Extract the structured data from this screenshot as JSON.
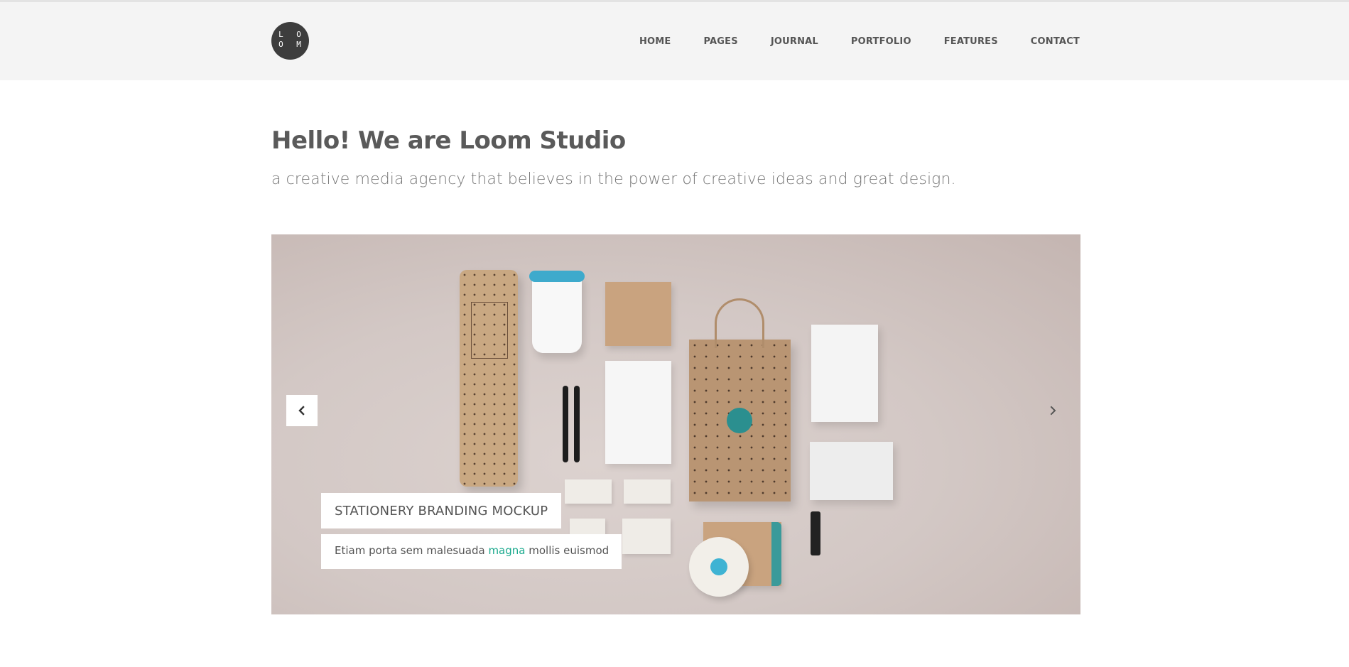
{
  "header": {
    "logo": {
      "line1": "L O",
      "line2": "O M"
    },
    "nav": [
      "HOME",
      "PAGES",
      "JOURNAL",
      "PORTFOLIO",
      "FEATURES",
      "CONTACT"
    ]
  },
  "intro": {
    "title": "Hello! We are Loom Studio",
    "subtitle": "a creative media agency that believes in the power of creative ideas and great design."
  },
  "slider": {
    "caption_title": "STATIONERY BRANDING MOCKUP",
    "caption_text_before": "Etiam porta sem malesuada ",
    "caption_text_accent": "magna",
    "caption_text_after": " mollis euismod",
    "prev_icon": "chevron-left-icon",
    "next_icon": "chevron-right-icon"
  },
  "colors": {
    "accent": "#1aa98d",
    "header_bg": "#f4f4f4",
    "logo_bg": "#3d3d3d",
    "slide_bg": "#d3c8c5"
  }
}
